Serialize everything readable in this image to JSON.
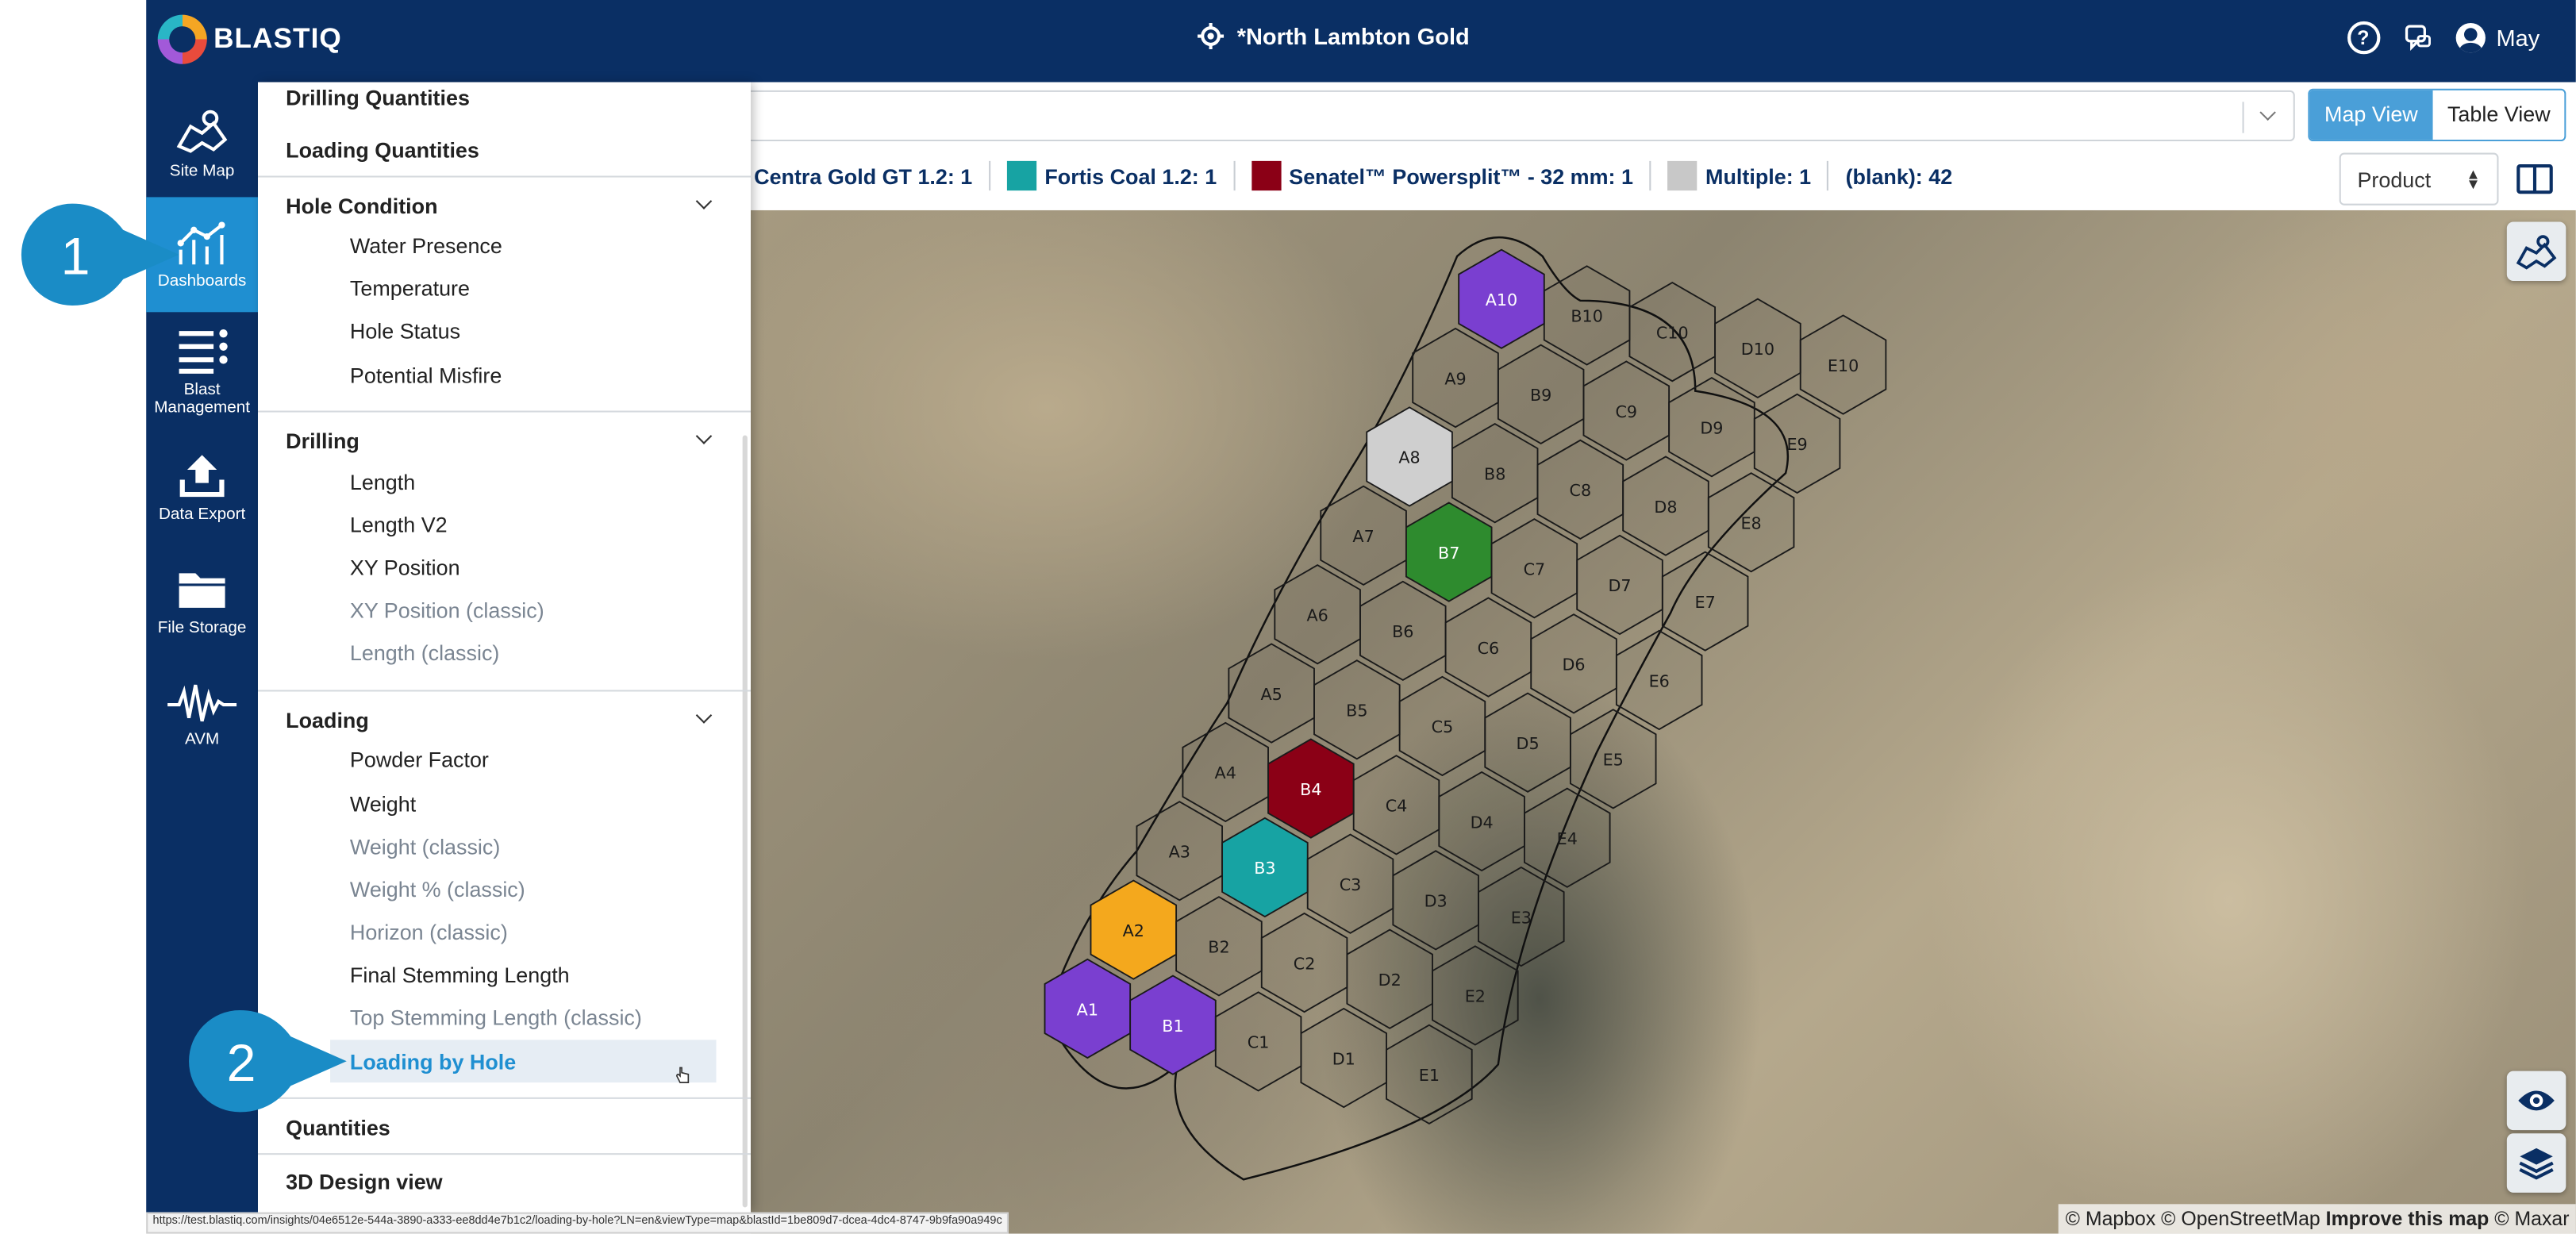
{
  "app": {
    "logo_text": "BLASTIQ",
    "site_title": "*North Lambton Gold",
    "user_name": "May"
  },
  "nav": {
    "items": [
      {
        "label": "Site Map",
        "icon": "map-icon"
      },
      {
        "label": "Dashboards",
        "icon": "dashboard-chart-icon",
        "active": true
      },
      {
        "label": "Blast Management",
        "icon": "list-icon"
      },
      {
        "label": "Data Export",
        "icon": "upload-icon"
      },
      {
        "label": "File Storage",
        "icon": "folder-icon"
      },
      {
        "label": "AVM",
        "icon": "waveform-icon"
      }
    ]
  },
  "menu": {
    "top_items": [
      "Drilling Quantities",
      "Loading Quantities"
    ],
    "sections": [
      {
        "title": "Hole Condition",
        "items": [
          "Water Presence",
          "Temperature",
          "Hole Status",
          "Potential Misfire"
        ]
      },
      {
        "title": "Drilling",
        "items": [
          "Length",
          "Length V2",
          "XY Position",
          "XY Position (classic)",
          "Length (classic)"
        ]
      },
      {
        "title": "Loading",
        "items": [
          "Powder Factor",
          "Weight",
          "Weight (classic)",
          "Weight % (classic)",
          "Horizon (classic)",
          "Final Stemming Length",
          "Top Stemming Length (classic)",
          "Loading by Hole"
        ]
      }
    ],
    "bottom_items": [
      "Quantities",
      "3D Design view"
    ],
    "selected": "Loading by Hole"
  },
  "toolbar": {
    "map_view": "Map View",
    "table_view": "Table View",
    "product_select": "Product"
  },
  "legend": [
    {
      "label": "Centra Gold GT 1.2: 1",
      "color": ""
    },
    {
      "label": "Fortis Coal 1.2: 1",
      "color": "#17a3a3"
    },
    {
      "label": "Senatel™ Powersplit™ - 32 mm: 1",
      "color": "#8b0016"
    },
    {
      "label": "Multiple: 1",
      "color": "#c8c8c8"
    },
    {
      "label": "(blank): 42",
      "color": ""
    }
  ],
  "map": {
    "holes": {
      "A": [
        "A1",
        "A2",
        "A3",
        "A4",
        "A5",
        "A6",
        "A7",
        "A8",
        "A9",
        "A10"
      ],
      "B": [
        "B1",
        "B2",
        "B3",
        "B4",
        "B5",
        "B6",
        "B7",
        "B8",
        "B9",
        "B10"
      ],
      "C": [
        "C1",
        "C2",
        "C3",
        "C4",
        "C5",
        "C6",
        "C7",
        "C8",
        "C9",
        "C10"
      ],
      "D": [
        "D1",
        "D2",
        "D3",
        "D4",
        "D5",
        "D6",
        "D7",
        "D8",
        "D9",
        "D10"
      ],
      "E": [
        "E1",
        "E2",
        "E3",
        "E4",
        "E5",
        "E6",
        "E7",
        "E8",
        "E9",
        "E10"
      ]
    },
    "fills": {
      "A10": "#7a3fd0",
      "A1": "#7a3fd0",
      "B1": "#7a3fd0",
      "A2": "#f4a81d",
      "B3": "#17a3a3",
      "B4": "#8b0016",
      "B7": "#2e8b2e",
      "A8": "#cfcfcf"
    },
    "attribution": {
      "mapbox": "© Mapbox",
      "osm": "© OpenStreetMap",
      "improve": "Improve this map",
      "maxar": "© Maxar"
    }
  },
  "callouts": {
    "one": "1",
    "two": "2"
  },
  "status_url": "https://test.blastiq.com/insights/04e6512e-544a-3890-a333-ee8dd4e7b1c2/loading-by-hole?LN=en&viewType=map&blastId=1be809d7-dcea-4dc4-8747-9b9fa90a949c"
}
